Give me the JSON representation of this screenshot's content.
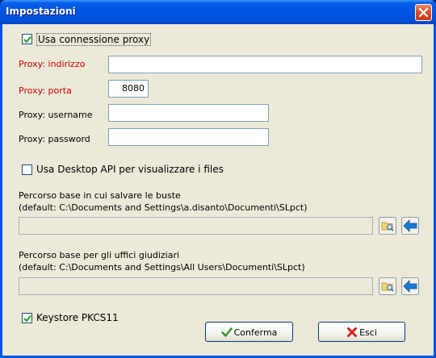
{
  "window": {
    "title": "Impostazioni"
  },
  "proxy": {
    "use_proxy_label": "Usa connessione proxy",
    "use_proxy_checked": true,
    "address_label": "Proxy: indirizzo",
    "address_value": "",
    "port_label": "Proxy: porta",
    "port_value": "8080",
    "username_label": "Proxy: username",
    "username_value": "",
    "password_label": "Proxy: password",
    "password_value": ""
  },
  "desktop_api": {
    "label": "Usa Desktop API per visualizzare i files",
    "checked": false
  },
  "save_path": {
    "line1": "Percorso base in cui salvare le buste",
    "line2": "(default: C:\\Documents and Settings\\a.disanto\\Documenti\\SLpct)",
    "value": ""
  },
  "offices_path": {
    "line1": "Percorso base per gli uffici giudiziari",
    "line2": "(default: C:\\Documents and Settings\\All Users\\Documenti\\SLpct)",
    "value": ""
  },
  "keystore": {
    "label": "Keystore PKCS11",
    "checked": true
  },
  "buttons": {
    "confirm": "Conferma",
    "exit": "Esci"
  },
  "colors": {
    "required_label": "#cc0000",
    "title_bar": "#0055e5",
    "dialog_bg": "#ece9d8"
  },
  "icons": [
    "close-icon",
    "check-icon",
    "browse-folder-icon",
    "reset-arrow-icon",
    "confirm-check-icon",
    "exit-x-icon"
  ]
}
